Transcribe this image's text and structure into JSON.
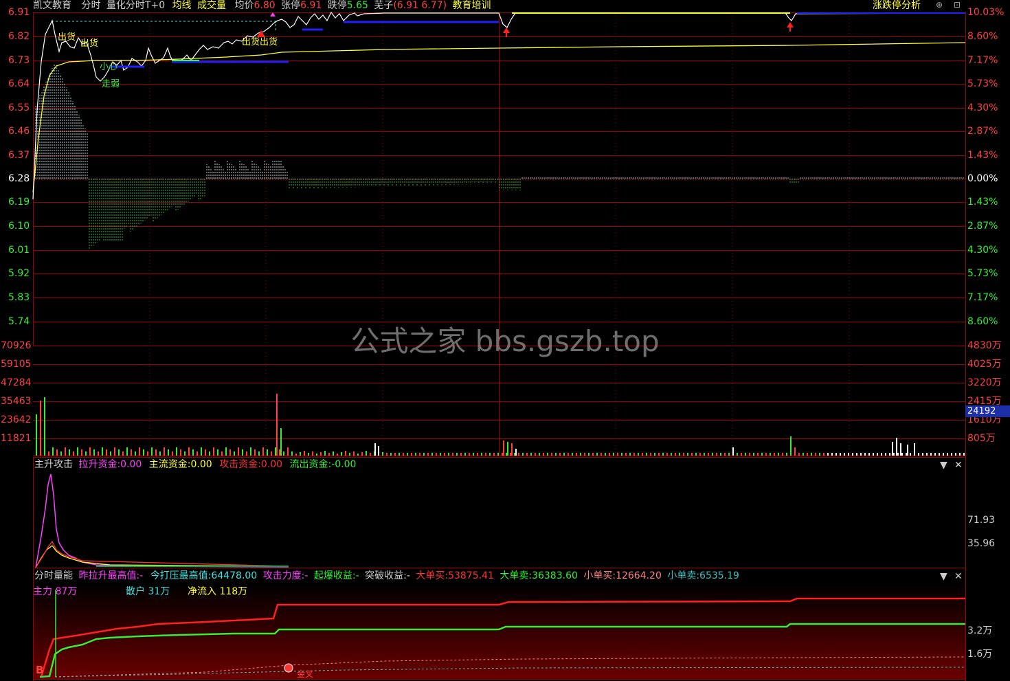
{
  "header": {
    "stock": "凯文教育",
    "mode": "分时",
    "indicator": "量化分时T+0",
    "avg_line": "均线",
    "volume": "成交量",
    "avg_price_label": "均价",
    "avg_price": "6.80",
    "limit_up_label": "张停",
    "limit_up": "6.91",
    "limit_down_label": "跌停",
    "limit_down": "5.65",
    "box_label": "芜子",
    "box_values": "(6.91 6.77)",
    "sector": "教育培训",
    "analysis_link": "涨跌停分析"
  },
  "price_axis": {
    "left": [
      "6.91",
      "6.82",
      "6.73",
      "6.64",
      "6.55",
      "6.46",
      "6.37",
      "6.28",
      "6.19",
      "6.10",
      "6.01",
      "5.92",
      "5.83",
      "5.74"
    ],
    "right": [
      "10.03%",
      "8.60%",
      "7.17%",
      "5.73%",
      "4.30%",
      "2.87%",
      "1.43%",
      "0.00%",
      "1.43%",
      "2.87%",
      "4.30%",
      "5.73%",
      "7.17%",
      "8.60%"
    ]
  },
  "volume_axis": {
    "left": [
      "70926",
      "59105",
      "47284",
      "35463",
      "23642",
      "11821"
    ],
    "right": [
      "4830万",
      "4025万",
      "3220万",
      "2415万",
      "1610万",
      "805万"
    ],
    "current": "24192"
  },
  "chart_labels": {
    "out1": "出货",
    "out2": "出货",
    "weak": "走弱",
    "small": "小心",
    "outbuy": "出货出货"
  },
  "panel1": {
    "title": "主升攻击",
    "pull_label": "拉升资金:",
    "pull_value": "0.00",
    "main_label": "主流资金:",
    "main_value": "0.00",
    "attack_label": "攻击资金:",
    "attack_value": "0.00",
    "out_label": "流出资金:",
    "out_value": "-0.00",
    "axis": [
      "71.93",
      "35.96"
    ]
  },
  "panel2": {
    "title": "分时量能",
    "y_pull_label": "昨拉升最高值:",
    "y_pull_value": "-",
    "t_press_label": "今打压最高值:",
    "t_press_value": "64478.00",
    "force_label": "攻击力度:",
    "force_value": "-",
    "burst_label": "起爆收益:",
    "burst_value": "-",
    "break_label": "突破收益:",
    "break_value": "-",
    "big_buy_label": "大单买:",
    "big_buy_value": "53875.41",
    "big_sell_label": "大单卖:",
    "big_sell_value": "36383.60",
    "small_buy_label": "小单买:",
    "small_buy_value": "12664.20",
    "small_sell_label": "小单卖:",
    "small_sell_value": "6535.19",
    "main_force": "主力 87万",
    "retail": "散户 31万",
    "net_inflow": "净流入 118万",
    "marker_b": "B",
    "marker_lock": "金叉",
    "axis": [
      "3.2万",
      "1.6万"
    ]
  },
  "watermark": "公式之家 bbs.gszb.top",
  "controls": {
    "dropdown": "▼",
    "close": "✕"
  },
  "colors": {
    "grid": "#8b0000",
    "price": "#ffffff",
    "avg": "#ffff33",
    "up": "#ff3333",
    "down": "#33cc33",
    "blue": "#3030ff"
  }
}
